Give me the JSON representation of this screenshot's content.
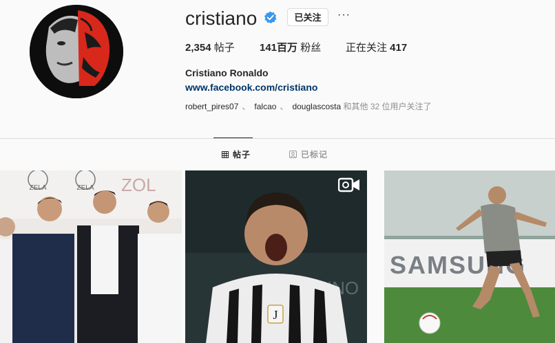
{
  "profile": {
    "username": "cristiano",
    "verified": true,
    "follow_button_label": "已关注",
    "more_label": "···",
    "full_name": "Cristiano Ronaldo",
    "link": "www.facebook.com/cristiano",
    "stats": {
      "posts_value": "2,354",
      "posts_label": " 帖子",
      "followers_value": "141百万",
      "followers_label": " 粉丝",
      "following_label": "正在关注 ",
      "following_value": "417"
    },
    "followed_by": {
      "names": [
        "robert_pires07",
        "falcao",
        "douglascosta"
      ],
      "separator": "、",
      "suffix": "和其他 32 位用户关注了"
    }
  },
  "tabs": {
    "posts_label": "帖子",
    "tagged_label": "已标记",
    "active": "posts"
  },
  "posts": [
    {
      "type": "photo",
      "logo_text": "ZELA",
      "brand_text": "ZOL"
    },
    {
      "type": "video",
      "icon": "video-icon",
      "bg_text": "FINO",
      "badge_text": "J"
    },
    {
      "type": "photo",
      "banner_text": "SAMSUNG"
    }
  ],
  "colors": {
    "link": "#003569",
    "verified": "#3897f0",
    "border": "#dbdbdb",
    "muted": "#8e8e8e",
    "text": "#262626"
  }
}
